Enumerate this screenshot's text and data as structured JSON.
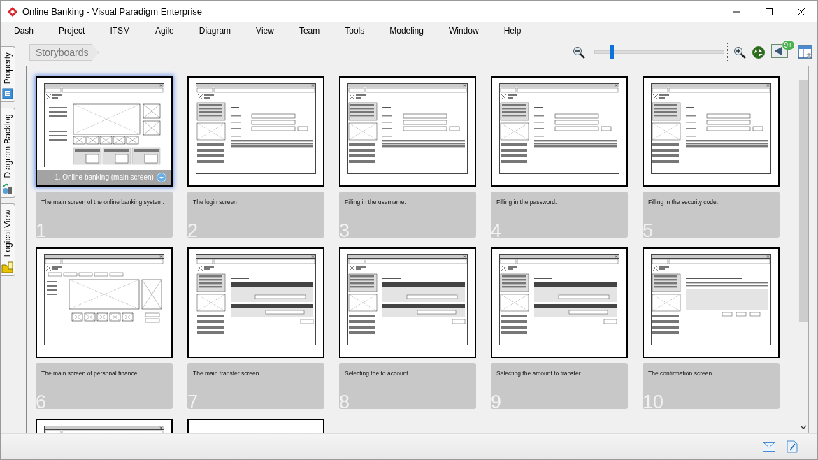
{
  "window": {
    "title": "Online Banking - Visual Paradigm Enterprise"
  },
  "menu": [
    "Dash",
    "Project",
    "ITSM",
    "Agile",
    "Diagram",
    "View",
    "Team",
    "Tools",
    "Modeling",
    "Window",
    "Help"
  ],
  "side_tabs": [
    {
      "label": "Property",
      "kind": "property"
    },
    {
      "label": "Diagram Backlog",
      "kind": "backlog"
    },
    {
      "label": "Logical View",
      "kind": "logical"
    }
  ],
  "breadcrumb": "Storyboards",
  "zoom": {
    "level": 0.12
  },
  "notifications": {
    "badge": "9+"
  },
  "cards": [
    {
      "number": "1",
      "caption": "1. Online banking (main screen)",
      "description": "The main screen of the online banking system.",
      "selected": true,
      "kind": "main"
    },
    {
      "number": "2",
      "description": "The login screen",
      "selected": false,
      "kind": "login"
    },
    {
      "number": "3",
      "description": "Filling in the username.",
      "selected": false,
      "kind": "login"
    },
    {
      "number": "4",
      "description": "Filling in the password.",
      "selected": false,
      "kind": "login"
    },
    {
      "number": "5",
      "description": "Filling in the security code.",
      "selected": false,
      "kind": "login"
    },
    {
      "number": "6",
      "description": "The main screen of personal finance.",
      "selected": false,
      "kind": "finance"
    },
    {
      "number": "7",
      "description": "The main transfer screen.",
      "selected": false,
      "kind": "transfer"
    },
    {
      "number": "8",
      "description": "Selecting the to account.",
      "selected": false,
      "kind": "transfer"
    },
    {
      "number": "9",
      "description": "Selecting the amount to transfer.",
      "selected": false,
      "kind": "transfer"
    },
    {
      "number": "10",
      "description": "The confirmation screen.",
      "selected": false,
      "kind": "confirm"
    },
    {
      "selected": false,
      "kind": "main"
    },
    {
      "selected": false,
      "kind": "blank"
    }
  ]
}
